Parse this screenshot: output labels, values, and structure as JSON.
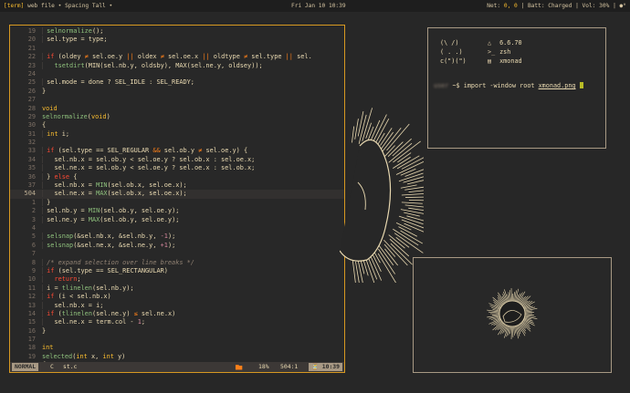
{
  "topbar": {
    "workspace": "[term]",
    "window_title": "web file • Spacing Tall •",
    "clock": "Fri Jan 10 10:39",
    "net_label": "Net:",
    "net_value": "0, 0",
    "batt": "| Batt: Charged | Vol: 30% |",
    "tray": "●ᴴ"
  },
  "editor": {
    "lines": [
      {
        "n": "19",
        "segs": [
          [
            "  ",
            " "
          ],
          [
            "fn",
            "selnormalize"
          ],
          [
            "pl",
            "();"
          ]
        ]
      },
      {
        "n": "20",
        "segs": [
          [
            "  ",
            " "
          ],
          [
            "pl",
            "sel.type = type;"
          ]
        ]
      },
      {
        "n": "21",
        "segs": []
      },
      {
        "n": "22",
        "segs": [
          [
            "  ",
            " "
          ],
          [
            "kw",
            "if"
          ],
          [
            "pl",
            " (oldey "
          ],
          [
            "op",
            "≠"
          ],
          [
            "pl",
            " sel.oe.y "
          ],
          [
            "op",
            "||"
          ],
          [
            "pl",
            " oldex "
          ],
          [
            "op",
            "≠"
          ],
          [
            "pl",
            " sel.oe.x "
          ],
          [
            "op",
            "||"
          ],
          [
            "pl",
            " oldtype "
          ],
          [
            "op",
            "≠"
          ],
          [
            "pl",
            " sel.type "
          ],
          [
            "op",
            "||"
          ],
          [
            "pl",
            " sel."
          ]
        ]
      },
      {
        "n": "23",
        "segs": [
          [
            "  ",
            "   "
          ],
          [
            "fn",
            "tsetdirt"
          ],
          [
            "pl",
            "(MIN(sel.nb.y, oldsby), MAX(sel.ne.y, oldsey));"
          ]
        ]
      },
      {
        "n": "24",
        "segs": []
      },
      {
        "n": "25",
        "segs": [
          [
            "  ",
            " "
          ],
          [
            "pl",
            "sel.mode = done ? SEL_IDLE : SEL_READY;"
          ]
        ]
      },
      {
        "n": "26",
        "segs": [
          [
            "pl",
            "}"
          ]
        ]
      },
      {
        "n": "27",
        "segs": []
      },
      {
        "n": "28",
        "segs": [
          [
            "ty",
            "void"
          ]
        ]
      },
      {
        "n": "29",
        "segs": [
          [
            "fn",
            "selnormalize"
          ],
          [
            "pl",
            "("
          ],
          [
            "ty",
            "void"
          ],
          [
            "pl",
            ")"
          ]
        ]
      },
      {
        "n": "30",
        "segs": [
          [
            "pl",
            "{"
          ]
        ]
      },
      {
        "n": "31",
        "segs": [
          [
            "  ",
            " "
          ],
          [
            "ty",
            "int"
          ],
          [
            "pl",
            " i;"
          ]
        ]
      },
      {
        "n": "32",
        "segs": []
      },
      {
        "n": "33",
        "segs": [
          [
            "  ",
            " "
          ],
          [
            "kw",
            "if"
          ],
          [
            "pl",
            " (sel.type == SEL_REGULAR "
          ],
          [
            "op",
            "&&"
          ],
          [
            "pl",
            " sel.ob.y "
          ],
          [
            "op",
            "≠"
          ],
          [
            "pl",
            " sel.oe.y) {"
          ]
        ]
      },
      {
        "n": "34",
        "segs": [
          [
            "  ",
            "   "
          ],
          [
            "pl",
            "sel.nb.x = sel.ob.y < sel.oe.y ? sel.ob.x : sel.oe.x;"
          ]
        ]
      },
      {
        "n": "35",
        "segs": [
          [
            "  ",
            "   "
          ],
          [
            "pl",
            "sel.ne.x = sel.ob.y < sel.oe.y ? sel.oe.x : sel.ob.x;"
          ]
        ]
      },
      {
        "n": "36",
        "segs": [
          [
            "  ",
            " "
          ],
          [
            "pl",
            "} "
          ],
          [
            "kw",
            "else"
          ],
          [
            "pl",
            " {"
          ]
        ]
      },
      {
        "n": "37",
        "segs": [
          [
            "  ",
            "   "
          ],
          [
            "pl",
            "sel.nb.x = "
          ],
          [
            "fn",
            "MIN"
          ],
          [
            "pl",
            "(sel.ob.x, sel.oe.x);"
          ]
        ]
      },
      {
        "n": "504",
        "current": true,
        "segs": [
          [
            "  ",
            "   "
          ],
          [
            "pl",
            "sel.ne.x = "
          ],
          [
            "fn",
            "MAX"
          ],
          [
            "pl",
            "(sel.ob.x, sel.oe.x);"
          ]
        ]
      },
      {
        "n": "1",
        "segs": [
          [
            "  ",
            " "
          ],
          [
            "pl",
            "}"
          ]
        ]
      },
      {
        "n": "2",
        "segs": [
          [
            "  ",
            " "
          ],
          [
            "pl",
            "sel.nb.y = "
          ],
          [
            "fn",
            "MIN"
          ],
          [
            "pl",
            "(sel.ob.y, sel.oe.y);"
          ]
        ]
      },
      {
        "n": "3",
        "segs": [
          [
            "  ",
            " "
          ],
          [
            "pl",
            "sel.ne.y = "
          ],
          [
            "fn",
            "MAX"
          ],
          [
            "pl",
            "(sel.ob.y, sel.oe.y);"
          ]
        ]
      },
      {
        "n": "4",
        "segs": []
      },
      {
        "n": "5",
        "segs": [
          [
            "  ",
            " "
          ],
          [
            "fn",
            "selsnap"
          ],
          [
            "pl",
            "(&sel.nb.x, &sel.nb.y, "
          ],
          [
            "num",
            "-1"
          ],
          [
            "pl",
            ");"
          ]
        ]
      },
      {
        "n": "6",
        "segs": [
          [
            "  ",
            " "
          ],
          [
            "fn",
            "selsnap"
          ],
          [
            "pl",
            "(&sel.ne.x, &sel.ne.y, "
          ],
          [
            "num",
            "+1"
          ],
          [
            "pl",
            ");"
          ]
        ]
      },
      {
        "n": "7",
        "segs": []
      },
      {
        "n": "8",
        "segs": [
          [
            "  ",
            " "
          ],
          [
            "cm",
            "/* expand selection over line breaks */"
          ]
        ]
      },
      {
        "n": "9",
        "segs": [
          [
            "  ",
            " "
          ],
          [
            "kw",
            "if"
          ],
          [
            "pl",
            " (sel.type == SEL_RECTANGULAR)"
          ]
        ]
      },
      {
        "n": "10",
        "segs": [
          [
            "  ",
            "   "
          ],
          [
            "kw",
            "return"
          ],
          [
            "pl",
            ";"
          ]
        ]
      },
      {
        "n": "11",
        "segs": [
          [
            "  ",
            " "
          ],
          [
            "pl",
            "i = "
          ],
          [
            "fn",
            "tlinelen"
          ],
          [
            "pl",
            "(sel.nb.y);"
          ]
        ]
      },
      {
        "n": "12",
        "segs": [
          [
            "  ",
            " "
          ],
          [
            "kw",
            "if"
          ],
          [
            "pl",
            " (i < sel.nb.x)"
          ]
        ]
      },
      {
        "n": "13",
        "segs": [
          [
            "  ",
            "   "
          ],
          [
            "pl",
            "sel.nb.x = i;"
          ]
        ]
      },
      {
        "n": "14",
        "segs": [
          [
            "  ",
            " "
          ],
          [
            "kw",
            "if"
          ],
          [
            "pl",
            " ("
          ],
          [
            "fn",
            "tlinelen"
          ],
          [
            "pl",
            "(sel.ne.y) "
          ],
          [
            "op",
            "≤"
          ],
          [
            "pl",
            " sel.ne.x)"
          ]
        ]
      },
      {
        "n": "15",
        "segs": [
          [
            "  ",
            "   "
          ],
          [
            "pl",
            "sel.ne.x = term.col - "
          ],
          [
            "num",
            "1"
          ],
          [
            "pl",
            ";"
          ]
        ]
      },
      {
        "n": "16",
        "segs": [
          [
            "pl",
            "}"
          ]
        ]
      },
      {
        "n": "17",
        "segs": []
      },
      {
        "n": "18",
        "segs": [
          [
            "ty",
            "int"
          ]
        ]
      },
      {
        "n": "19",
        "segs": [
          [
            "fn",
            "selected"
          ],
          [
            "pl",
            "("
          ],
          [
            "ty",
            "int"
          ],
          [
            "pl",
            " x, "
          ],
          [
            "ty",
            "int"
          ],
          [
            "pl",
            " y)"
          ]
        ]
      },
      {
        "n": "20",
        "segs": [
          [
            "pl",
            "{"
          ]
        ]
      }
    ],
    "status": {
      "mode": "NORMAL",
      "filetype": "C",
      "filename": "st.c",
      "encoding": "▆▅",
      "percent": "18%",
      "position": "504:1",
      "clock": "⏳ 10:39"
    }
  },
  "terminal": {
    "fetch": [
      {
        "art": "(\\ /)",
        "icon": "△",
        "value": "6.6.70"
      },
      {
        "art": "( . .)",
        "icon": ">_",
        "value": "zsh"
      },
      {
        "art": "c(\")(\")",
        "icon": "▤",
        "value": "xmonad"
      }
    ],
    "prompt_host": "user",
    "prompt_path": "~$",
    "cmd": "import -window root",
    "cmd_arg": "xmonad.png"
  },
  "colors": {
    "accent": "#d79921",
    "background": "#272727",
    "foreground": "#d5c4a1"
  }
}
